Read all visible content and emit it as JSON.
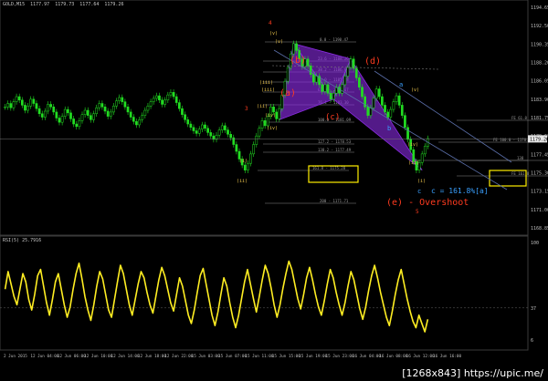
{
  "header": {
    "symbol": "GOLD,M15",
    "o": "1177.97",
    "h": "1179.73",
    "l": "1177.64",
    "c": "1179.26"
  },
  "rsi_header": "RSI(5) 25.7916",
  "watermark": "[1268x843] https://upic.me/",
  "colors": {
    "background": "#000000",
    "candle": "#22dd22",
    "rsi": "#ffee22",
    "pattern": "#8a2be2",
    "fib": "#8a8a8a",
    "box": "#ffee00",
    "wave_red": "#ff3b1f",
    "wave_blue": "#3aa0ff",
    "roman": "#e8c24a"
  },
  "price_axis": [
    "1194.65",
    "1192.50",
    "1190.35",
    "1188.20",
    "1186.05",
    "1183.90",
    "1181.75",
    "1179.60",
    "1177.45",
    "1175.30",
    "1173.15",
    "1171.00",
    "1168.85"
  ],
  "current_price": "1179.26",
  "rsi_axis": [
    "100",
    "37",
    "6"
  ],
  "time_axis": [
    "2 Jun 2015",
    "12 Jun 04:00",
    "12 Jun 06:00",
    "12 Jun 10:00",
    "12 Jun 14:00",
    "12 Jun 18:00",
    "12 Jun 22:00",
    "15 Jun 03:00",
    "15 Jun 07:00",
    "15 Jun 11:00",
    "15 Jun 15:00",
    "15 Jun 19:00",
    "15 Jun 23:00",
    "16 Jun 04:00",
    "16 Jun 08:00",
    "16 Jun 12:00",
    "16 Jun 16:00"
  ],
  "fib_labels": [
    {
      "text": "0.0 - 1190.47",
      "rx": 350,
      "ry": 46
    },
    {
      "text": "23.6 - 1188.26",
      "rx": 348,
      "ry": 67
    },
    {
      "text": "38.2 - 1186.89",
      "rx": 348,
      "ry": 79
    },
    {
      "text": "50.0 - 1185.78",
      "rx": 348,
      "ry": 90
    },
    {
      "text": "61.8 - 1184.67",
      "rx": 348,
      "ry": 101
    },
    {
      "text": "76.4 - 1183.30",
      "rx": 348,
      "ry": 115
    },
    {
      "text": "100.0 - 1181.09",
      "rx": 348,
      "ry": 134
    },
    {
      "text": "127.2 - 1178.53",
      "rx": 348,
      "ry": 158
    },
    {
      "text": "138.2 - 1177.49",
      "rx": 348,
      "ry": 167
    },
    {
      "text": "161.8 - 1175.28",
      "rx": 342,
      "ry": 187
    },
    {
      "text": "200 - 1171.71",
      "rx": 350,
      "ry": 223
    },
    {
      "text": "FE 61.8",
      "rx": 560,
      "ry": 132
    },
    {
      "text": "FE 100.0 - 1178.69",
      "rx": 540,
      "ry": 156
    },
    {
      "text": "138",
      "rx": 566,
      "ry": 176
    },
    {
      "text": "FE 161.8",
      "rx": 560,
      "ry": 193
    }
  ],
  "annotations": {
    "a_paren": "(a)",
    "b_paren": "(b)",
    "c_paren": "(c)",
    "d_paren": "(d)",
    "e_overshoot": "(e) - Overshoot",
    "a_blue": "a",
    "b_blue": "b",
    "c_blue": "c",
    "c_fib": "c = 161.8%[a]",
    "num4": "4",
    "num3": "3",
    "num5": "5"
  },
  "roman_labels": [
    "(v)",
    "(iii)",
    "(i)",
    "(iv)",
    "(ii)",
    "(v)",
    "(iii)",
    "(ii)",
    "(iv)",
    "(v)",
    "(iv)",
    "(ii)",
    "(i)"
  ],
  "chart_data": {
    "type": "line",
    "title": "GOLD,M15",
    "series": [
      {
        "name": "GOLD,M15",
        "values": [
          1183.0,
          1183.4,
          1182.9,
          1183.6,
          1184.2,
          1183.8,
          1183.2,
          1182.6,
          1183.1,
          1183.9,
          1183.4,
          1182.8,
          1182.2,
          1181.8,
          1182.5,
          1183.3,
          1183.0,
          1182.4,
          1181.7,
          1181.2,
          1181.9,
          1182.7,
          1182.3,
          1181.6,
          1181.0,
          1180.7,
          1181.4,
          1182.1,
          1182.6,
          1182.0,
          1181.5,
          1182.2,
          1182.9,
          1183.4,
          1183.0,
          1182.5,
          1181.9,
          1182.4,
          1183.1,
          1183.7,
          1184.1,
          1183.6,
          1183.0,
          1182.4,
          1181.8,
          1181.3,
          1180.9,
          1181.5,
          1182.0,
          1182.6,
          1183.1,
          1183.6,
          1184.0,
          1184.3,
          1183.8,
          1183.3,
          1183.8,
          1184.4,
          1184.7,
          1184.2,
          1183.5,
          1182.8,
          1182.1,
          1181.5,
          1181.0,
          1180.6,
          1180.2,
          1179.9,
          1180.4,
          1180.9,
          1180.5,
          1180.0,
          1179.6,
          1179.2,
          1179.7,
          1180.3,
          1180.8,
          1180.3,
          1179.8,
          1179.4,
          1178.6,
          1177.8,
          1176.9,
          1176.2,
          1175.6,
          1176.4,
          1177.5,
          1178.6,
          1179.6,
          1180.5,
          1181.4,
          1180.8,
          1181.9,
          1183.0,
          1182.4,
          1181.6,
          1182.8,
          1184.4,
          1186.0,
          1187.6,
          1189.2,
          1190.4,
          1189.6,
          1188.6,
          1187.7,
          1188.6,
          1187.8,
          1186.8,
          1185.9,
          1186.6,
          1185.6,
          1184.8,
          1185.6,
          1184.6,
          1183.9,
          1184.6,
          1185.3,
          1184.6,
          1185.6,
          1186.6,
          1187.6,
          1188.6,
          1187.5,
          1186.4,
          1185.3,
          1184.2,
          1183.0,
          1182.0,
          1182.9,
          1184.0,
          1185.1,
          1184.2,
          1183.2,
          1182.4,
          1181.8,
          1182.7,
          1183.6,
          1184.3,
          1183.2,
          1182.0,
          1180.6,
          1179.2,
          1178.0,
          1176.6,
          1175.6,
          1176.5,
          1177.5,
          1178.4,
          1179.3
        ]
      }
    ],
    "ylabel": "",
    "ylim": [
      1168.85,
      1194.65
    ],
    "rsi": {
      "name": "RSI(5)",
      "last": 25.7916,
      "ylim": [
        0,
        100
      ],
      "levels": [
        37
      ],
      "values": [
        55,
        72,
        60,
        48,
        40,
        55,
        70,
        62,
        45,
        35,
        50,
        68,
        74,
        58,
        42,
        30,
        45,
        62,
        70,
        55,
        40,
        28,
        38,
        55,
        70,
        80,
        65,
        48,
        35,
        25,
        40,
        58,
        72,
        65,
        50,
        35,
        28,
        45,
        62,
        78,
        70,
        55,
        40,
        30,
        45,
        60,
        72,
        66,
        52,
        40,
        32,
        48,
        64,
        76,
        68,
        55,
        42,
        34,
        50,
        66,
        58,
        44,
        30,
        22,
        35,
        52,
        68,
        75,
        60,
        45,
        30,
        20,
        33,
        50,
        66,
        58,
        42,
        28,
        18,
        30,
        46,
        62,
        74,
        60,
        46,
        33,
        48,
        64,
        78,
        70,
        56,
        40,
        28,
        40,
        56,
        70,
        82,
        74,
        60,
        46,
        36,
        50,
        66,
        76,
        64,
        50,
        38,
        30,
        44,
        60,
        74,
        66,
        52,
        40,
        30,
        42,
        58,
        72,
        64,
        50,
        36,
        26,
        38,
        54,
        68,
        78,
        66,
        52,
        40,
        28,
        20,
        34,
        50,
        64,
        74,
        60,
        46,
        34,
        24,
        18,
        30,
        22,
        14,
        26
      ]
    }
  }
}
